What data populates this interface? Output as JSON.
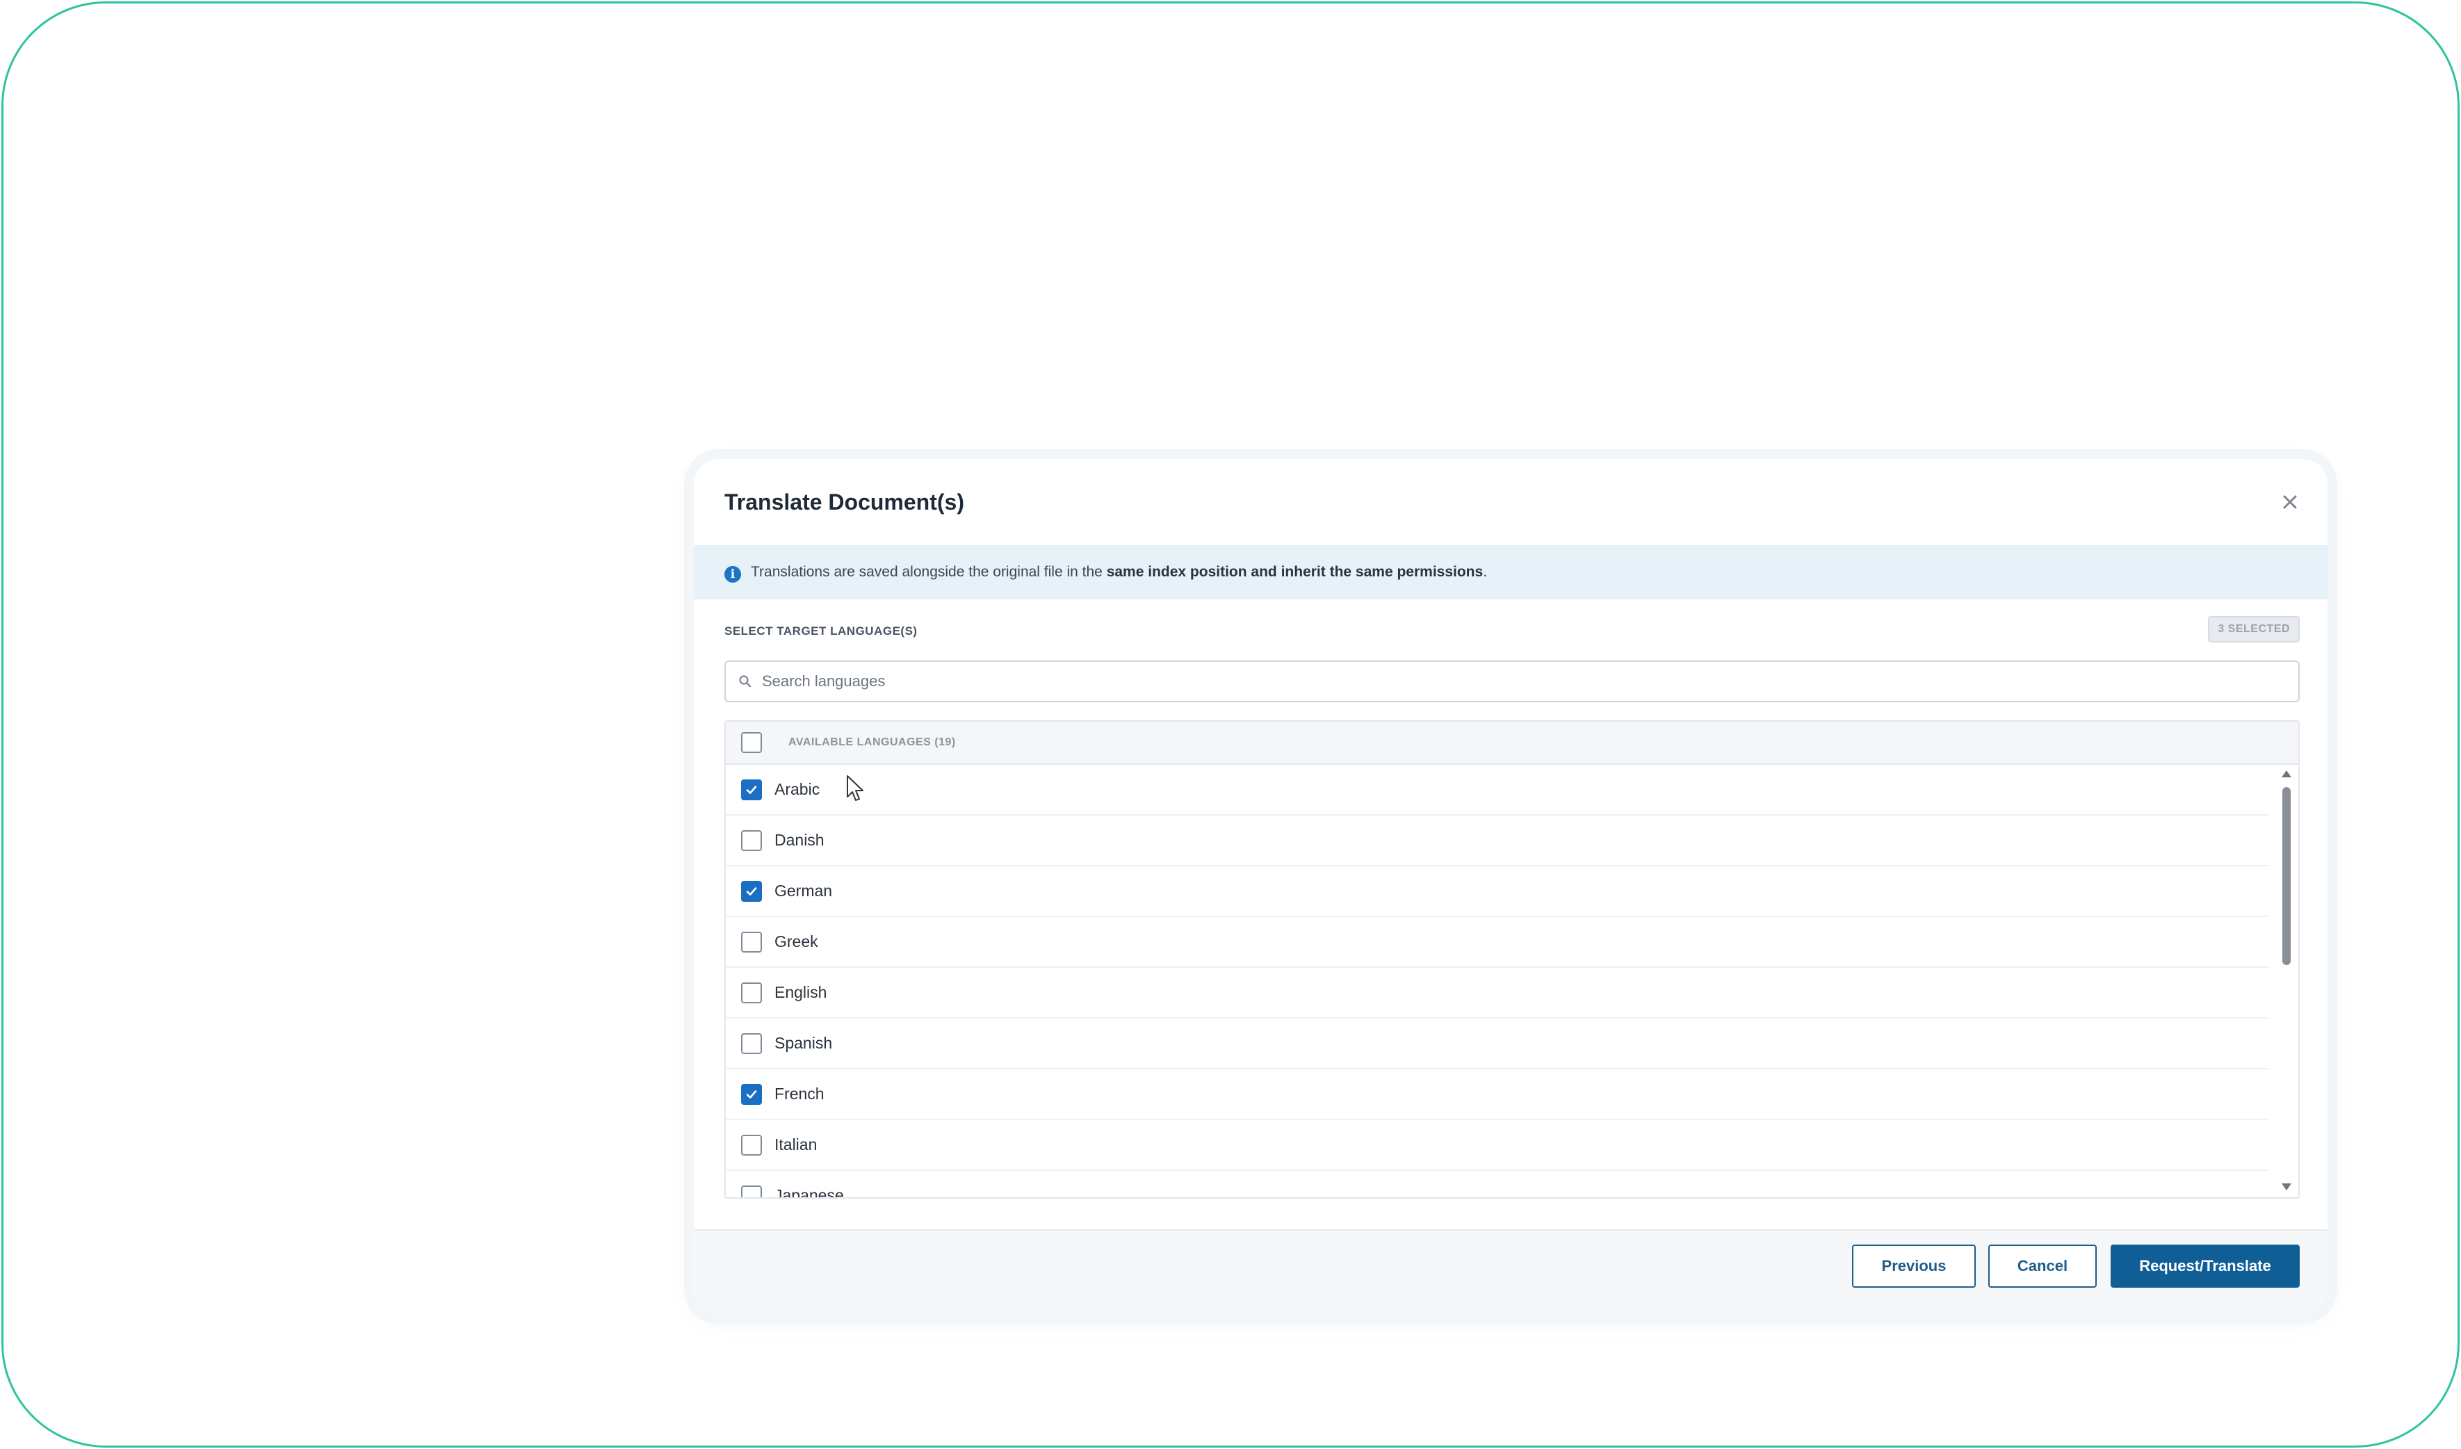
{
  "dialog": {
    "title": "Translate Document(s)",
    "close_icon": "close-icon"
  },
  "info": {
    "icon": "info-icon",
    "text_prefix": "Translations are saved alongside the original file in the ",
    "text_bold": "same index position and inherit the same permissions",
    "text_suffix": "."
  },
  "languages_section": {
    "label": "SELECT TARGET LANGUAGE(S)",
    "selected_badge": "3 SELECTED",
    "search_placeholder": "Search languages",
    "search_value": "",
    "list_header": "AVAILABLE LANGUAGES (19)",
    "select_all_checked": false,
    "items": [
      {
        "label": "Arabic",
        "checked": true
      },
      {
        "label": "Danish",
        "checked": false
      },
      {
        "label": "German",
        "checked": true
      },
      {
        "label": "Greek",
        "checked": false
      },
      {
        "label": "English",
        "checked": false
      },
      {
        "label": "Spanish",
        "checked": false
      },
      {
        "label": "French",
        "checked": true
      },
      {
        "label": "Italian",
        "checked": false
      },
      {
        "label": "Japanese",
        "checked": false
      }
    ]
  },
  "footer": {
    "previous_label": "Previous",
    "cancel_label": "Cancel",
    "submit_label": "Request/Translate"
  },
  "colors": {
    "accent": "#1b6fc2",
    "primary_button": "#0f5f96",
    "info_bg": "#e6f1f8",
    "frame_border": "#2ec4a0"
  }
}
